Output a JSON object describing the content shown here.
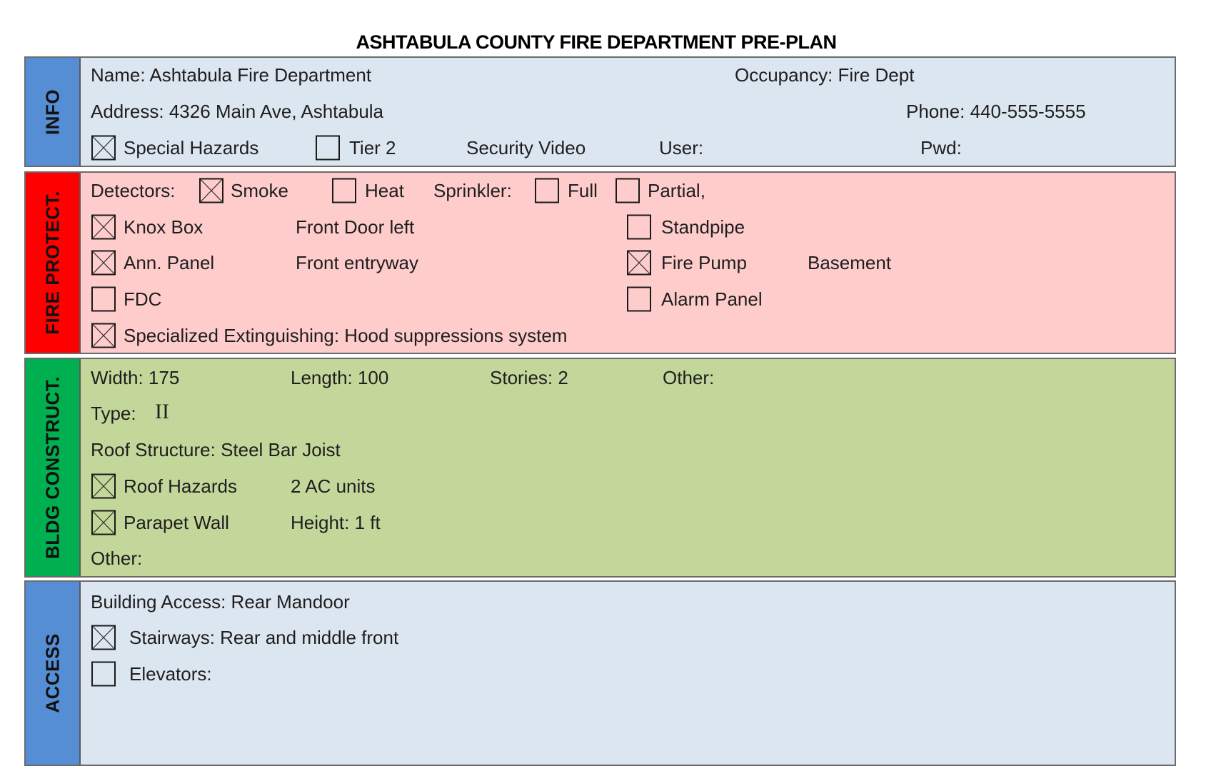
{
  "title": "ASHTABULA COUNTY FIRE DEPARTMENT PRE-PLAN",
  "sections": {
    "info": {
      "label": "INFO",
      "color": "#558ED5",
      "background": "#DCE6F1",
      "name": "Name: Ashtabula Fire Department",
      "occupancy": "Occupancy: Fire Dept",
      "address": "Address: 4326 Main Ave, Ashtabula",
      "phone": "Phone: 440-555-5555",
      "special_hazards": {
        "label": "Special Hazards",
        "checked": true
      },
      "tier2": {
        "label": "Tier 2",
        "checked": false
      },
      "security_video": "Security Video",
      "user": "User:",
      "pwd": "Pwd:"
    },
    "fire_protect": {
      "label": "FIRE PROTECT.",
      "color": "#FF0000",
      "background": "#FFCCCC",
      "detectors_label": "Detectors:",
      "smoke": {
        "label": "Smoke",
        "checked": true
      },
      "heat": {
        "label": "Heat",
        "checked": false
      },
      "sprinkler_label": "Sprinkler:",
      "full": {
        "label": "Full",
        "checked": false
      },
      "partial": {
        "label": "Partial,",
        "checked": false
      },
      "knox_box": {
        "label": "Knox Box",
        "checked": true,
        "location": "Front Door left"
      },
      "ann_panel": {
        "label": "Ann. Panel",
        "checked": true,
        "location": "Front entryway"
      },
      "fdc": {
        "label": "FDC",
        "checked": false
      },
      "standpipe": {
        "label": "Standpipe",
        "checked": false
      },
      "fire_pump": {
        "label": "Fire Pump",
        "checked": true,
        "location": "Basement"
      },
      "alarm_panel": {
        "label": "Alarm Panel",
        "checked": false
      },
      "specialized": {
        "label": "Specialized Extinguishing: Hood suppressions system",
        "checked": true
      }
    },
    "bldg_construct": {
      "label": "BLDG CONSTRUCT.",
      "color": "#00B050",
      "background": "#C4D79B",
      "width": "Width: 175",
      "length": "Length: 100",
      "stories": "Stories: 2",
      "other_top": "Other:",
      "type_label": "Type:",
      "type_value": "II",
      "roof_structure": "Roof Structure: Steel Bar Joist",
      "roof_hazards": {
        "label": "Roof Hazards",
        "checked": true,
        "detail": "2 AC units"
      },
      "parapet_wall": {
        "label": "Parapet Wall",
        "checked": true,
        "detail": "Height: 1 ft"
      },
      "other_bottom": "Other:"
    },
    "access": {
      "label": "ACCESS",
      "color": "#558ED5",
      "background": "#DCE6F1",
      "building_access": "Building Access: Rear Mandoor",
      "stairways": {
        "label": "Stairways: Rear and middle front",
        "checked": true
      },
      "elevators": {
        "label": "Elevators:",
        "checked": false
      }
    }
  }
}
